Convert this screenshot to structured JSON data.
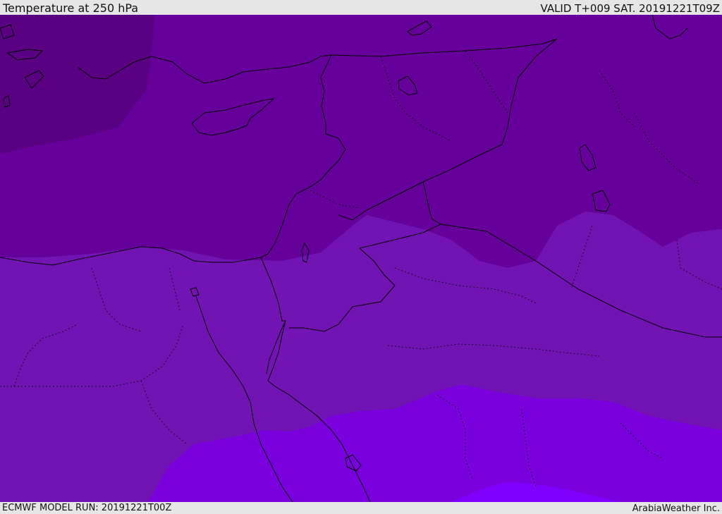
{
  "header": {
    "title": "Temperature at 250 hPa",
    "valid": "VALID T+009 SAT. 20191221T09Z"
  },
  "footer": {
    "model_run": "ECMWF MODEL RUN: 20191221T00Z",
    "credit": "ArabiaWeather Inc."
  },
  "map": {
    "field": "temperature",
    "level": "250 hPa",
    "temperature_bands": [
      {
        "name": "coldest",
        "color": "#5a0082"
      },
      {
        "name": "cold",
        "color": "#65009a"
      },
      {
        "name": "mid",
        "color": "#7213b3"
      },
      {
        "name": "warm",
        "color": "#7a00dd"
      },
      {
        "name": "warmest",
        "color": "#8000ff"
      }
    ],
    "coastline_color": "#000000",
    "border_color": "#000000"
  }
}
